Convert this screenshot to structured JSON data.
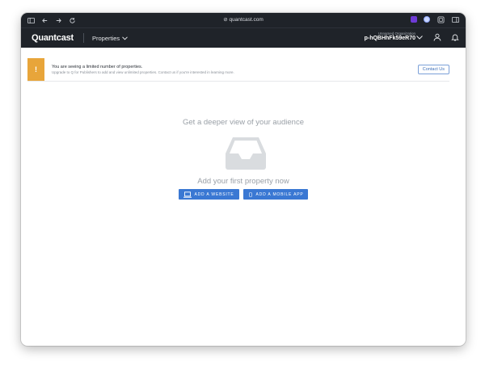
{
  "browser": {
    "url": "quantcast.com",
    "icons": [
      "sidebar-toggle-icon",
      "back-icon",
      "forward-icon",
      "reload-icon",
      "extension-icon",
      "profile-icon",
      "tab-overview-icon",
      "sidebar-right-icon"
    ]
  },
  "navbar": {
    "logo": "Quantcast",
    "menu_label": "Properties",
    "org_name": "Unnamed Organization",
    "org_id": "p-hQBHhFk59eR70"
  },
  "banner": {
    "warning_symbol": "!",
    "title": "You are seeing a limited number of properties.",
    "subtitle": "Upgrade to Q for Publishers to add and view unlimited properties. Contact us if you're interested in learning more.",
    "contact_label": "Contact Us"
  },
  "empty_state": {
    "headline": "Get a deeper view of your audience",
    "prompt": "Add your first property now",
    "add_website_label": "ADD A WEBSITE",
    "add_mobile_app_label": "ADD A MOBILE APP"
  },
  "colors": {
    "nav_bg": "#1f2329",
    "warning": "#e8a53a",
    "primary": "#3a78d3",
    "muted_text": "#9aa0a7"
  }
}
